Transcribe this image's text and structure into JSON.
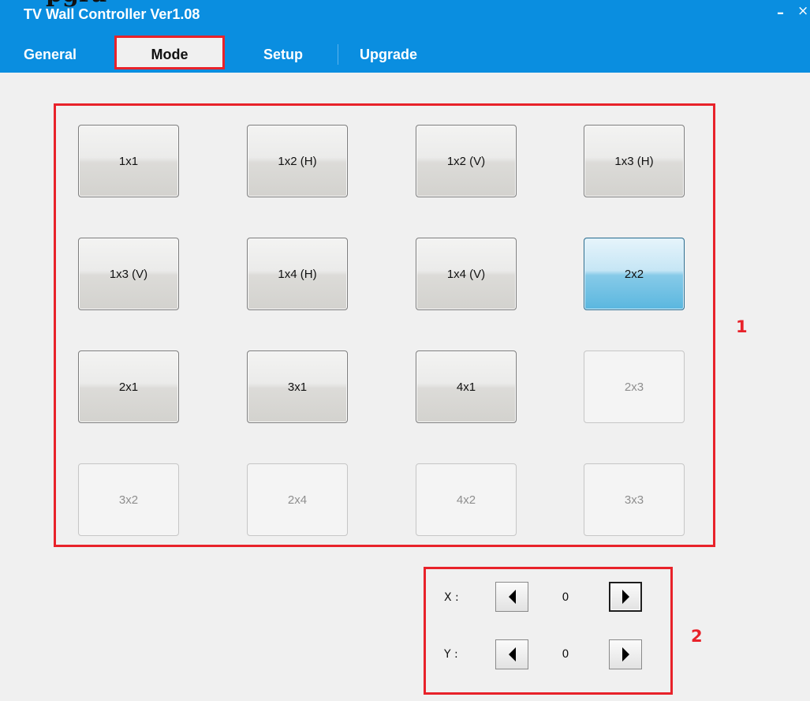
{
  "page_heading": "pgra",
  "window": {
    "title": "TV Wall Controller Ver1.08",
    "minimize_glyph": "–",
    "close_glyph": "×"
  },
  "tabs": [
    {
      "label": "General",
      "active": false
    },
    {
      "label": "Mode",
      "active": true
    },
    {
      "label": "Setup",
      "active": false
    },
    {
      "label": "Upgrade",
      "active": false
    }
  ],
  "mode_grid": {
    "buttons": [
      {
        "label": "1x1",
        "state": "normal"
      },
      {
        "label": "1x2 (H)",
        "state": "normal"
      },
      {
        "label": "1x2 (V)",
        "state": "normal"
      },
      {
        "label": "1x3 (H)",
        "state": "normal"
      },
      {
        "label": "1x3 (V)",
        "state": "normal"
      },
      {
        "label": "1x4 (H)",
        "state": "normal"
      },
      {
        "label": "1x4 (V)",
        "state": "normal"
      },
      {
        "label": "2x2",
        "state": "selected"
      },
      {
        "label": "2x1",
        "state": "normal"
      },
      {
        "label": "3x1",
        "state": "normal"
      },
      {
        "label": "4x1",
        "state": "normal"
      },
      {
        "label": "2x3",
        "state": "disabled"
      },
      {
        "label": "3x2",
        "state": "disabled"
      },
      {
        "label": "2x4",
        "state": "disabled"
      },
      {
        "label": "4x2",
        "state": "disabled"
      },
      {
        "label": "3x3",
        "state": "disabled"
      }
    ]
  },
  "position": {
    "x_label": "X :",
    "x_value": "0",
    "y_label": "Y :",
    "y_value": "0"
  },
  "annotations": {
    "box1_label": "1",
    "box2_label": "2"
  },
  "colors": {
    "titlebar": "#0a8ee0",
    "annotation_red": "#e8222a",
    "selected_blue": "#5ab7df"
  }
}
